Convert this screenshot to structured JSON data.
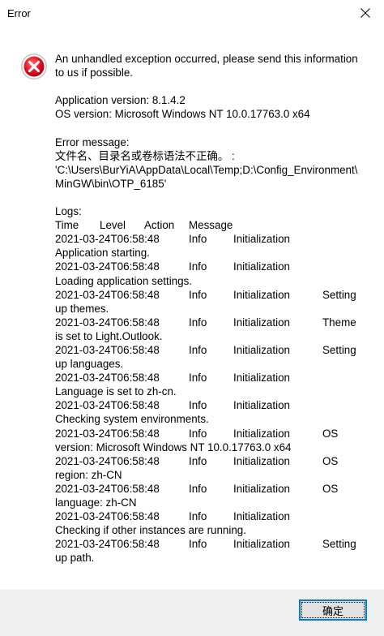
{
  "window": {
    "title": "Error"
  },
  "dialog": {
    "message_lines": [
      "An unhandled exception occurred, please send this information",
      "to us if possible."
    ],
    "app_version": "Application version: 8.1.4.2",
    "os_version": "OS version: Microsoft Windows NT 10.0.17763.0 x64",
    "error_message_label": "Error message:",
    "error_message_lines": [
      "文件名、目录名或卷标语法不正确。 :",
      "'C:\\Users\\BurYiA\\AppData\\Local\\Temp;D:\\Config_Environment\\",
      "MinGW\\bin\\OTP_6185'"
    ],
    "logs_label": "Logs:",
    "log_headers": [
      "Time",
      "Level",
      "Action",
      "Message"
    ],
    "log_entries": [
      {
        "time": "2021-03-24T06:58:48",
        "level": "Info",
        "action": "Initialization",
        "message": "",
        "cont": "Application starting."
      },
      {
        "time": "2021-03-24T06:58:48",
        "level": "Info",
        "action": "Initialization",
        "message": "",
        "cont": "Loading application settings."
      },
      {
        "time": "2021-03-24T06:58:48",
        "level": "Info",
        "action": "Initialization",
        "message": "Setting",
        "cont": "up themes."
      },
      {
        "time": "2021-03-24T06:58:48",
        "level": "Info",
        "action": "Initialization",
        "message": "Theme",
        "cont": "is set to Light.Outlook."
      },
      {
        "time": "2021-03-24T06:58:48",
        "level": "Info",
        "action": "Initialization",
        "message": "Setting",
        "cont": "up languages."
      },
      {
        "time": "2021-03-24T06:58:48",
        "level": "Info",
        "action": "Initialization",
        "message": "",
        "cont": "Language is set to zh-cn."
      },
      {
        "time": "2021-03-24T06:58:48",
        "level": "Info",
        "action": "Initialization",
        "message": "",
        "cont": "Checking system environments."
      },
      {
        "time": "2021-03-24T06:58:48",
        "level": "Info",
        "action": "Initialization",
        "message": "OS",
        "cont": "version: Microsoft Windows NT 10.0.17763.0 x64"
      },
      {
        "time": "2021-03-24T06:58:48",
        "level": "Info",
        "action": "Initialization",
        "message": "OS",
        "cont": "region: zh-CN"
      },
      {
        "time": "2021-03-24T06:58:48",
        "level": "Info",
        "action": "Initialization",
        "message": "OS",
        "cont": "language: zh-CN"
      },
      {
        "time": "2021-03-24T06:58:48",
        "level": "Info",
        "action": "Initialization",
        "message": "",
        "cont": "Checking if other instances are running."
      },
      {
        "time": "2021-03-24T06:58:48",
        "level": "Info",
        "action": "Initialization",
        "message": "Setting",
        "cont": "up path."
      }
    ]
  },
  "footer": {
    "ok_label": "确定"
  },
  "colors": {
    "error_red": "#e81123",
    "focus_blue": "#0078d7",
    "footer_bg": "#f0f0f0",
    "button_bg": "#e1e1e1"
  },
  "icons": {
    "close": "close-icon",
    "error": "error-icon"
  }
}
